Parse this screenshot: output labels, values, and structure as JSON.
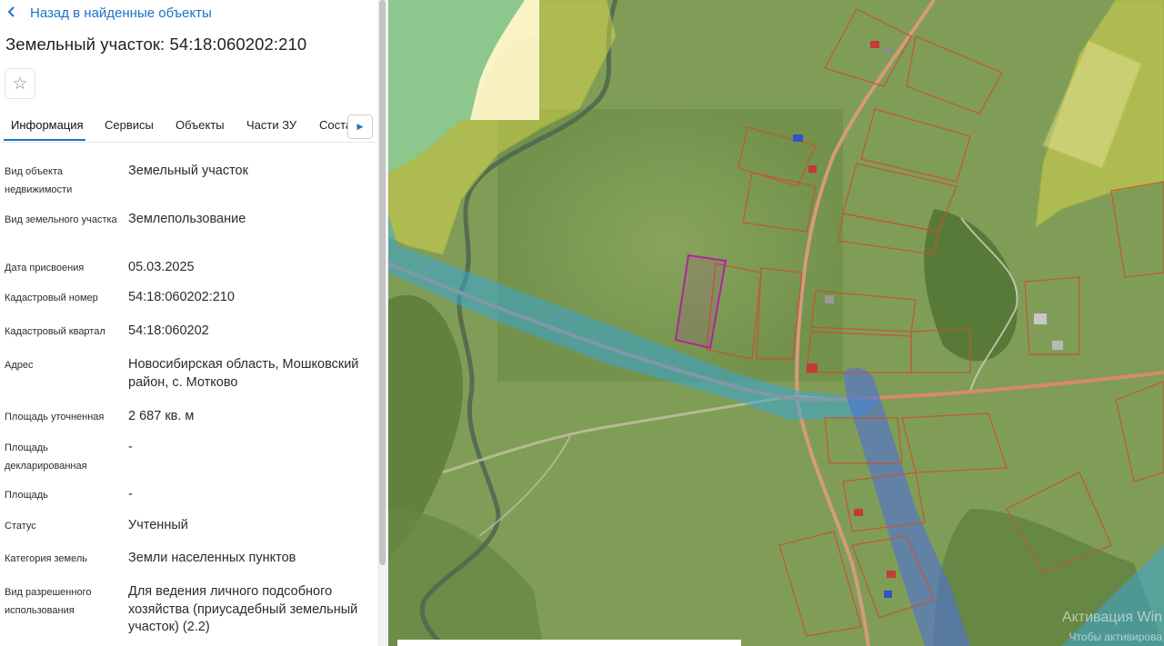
{
  "panel": {
    "back_label": "Назад в найденные объекты",
    "back_icon": "chevron-left-icon",
    "title": "Земельный участок: 54:18:060202:210",
    "favorite_icon": "star-outline-icon",
    "favorite_glyph": "☆",
    "tabs": [
      "Информация",
      "Сервисы",
      "Объекты",
      "Части ЗУ",
      "Состав"
    ],
    "tab_next_icon": "triangle-right-icon",
    "props": [
      {
        "label": "Вид объекта недвижимости",
        "value": "Земельный участок"
      },
      {
        "label": "Вид земельного участка",
        "value": "Землепользование"
      },
      {
        "label": "Дата присвоения",
        "value": "05.03.2025"
      },
      {
        "label": "Кадастровый номер",
        "value": "54:18:060202:210"
      },
      {
        "label": "Кадастровый квартал",
        "value": "54:18:060202"
      },
      {
        "label": "Адрес",
        "value": "Новосибирская область, Мошковский район, с. Мотково"
      },
      {
        "label": "Площадь уточненная",
        "value": "2 687 кв. м"
      },
      {
        "label": "Площадь декларированная",
        "value": "-"
      },
      {
        "label": "Площадь",
        "value": "-"
      },
      {
        "label": "Статус",
        "value": "Учтенный"
      },
      {
        "label": "Категория земель",
        "value": "Земли населенных пунктов"
      },
      {
        "label": "Вид разрешенного использования",
        "value": "Для ведения личного подсобного хозяйства (приусадебный земельный участок) (2.2)"
      }
    ]
  },
  "map": {
    "watermark_line1": "Активация Win",
    "watermark_line2": "Чтобы активирова",
    "colors": {
      "field": "#7c9a54",
      "forest_zone": "#2c8a2c",
      "zone_yellow": "#e5e14a",
      "water_zone": "#3aa6d6",
      "road_zone": "#4d6fd8",
      "parcel_line": "#c8532e",
      "selected_parcel": "#b0249e"
    }
  }
}
